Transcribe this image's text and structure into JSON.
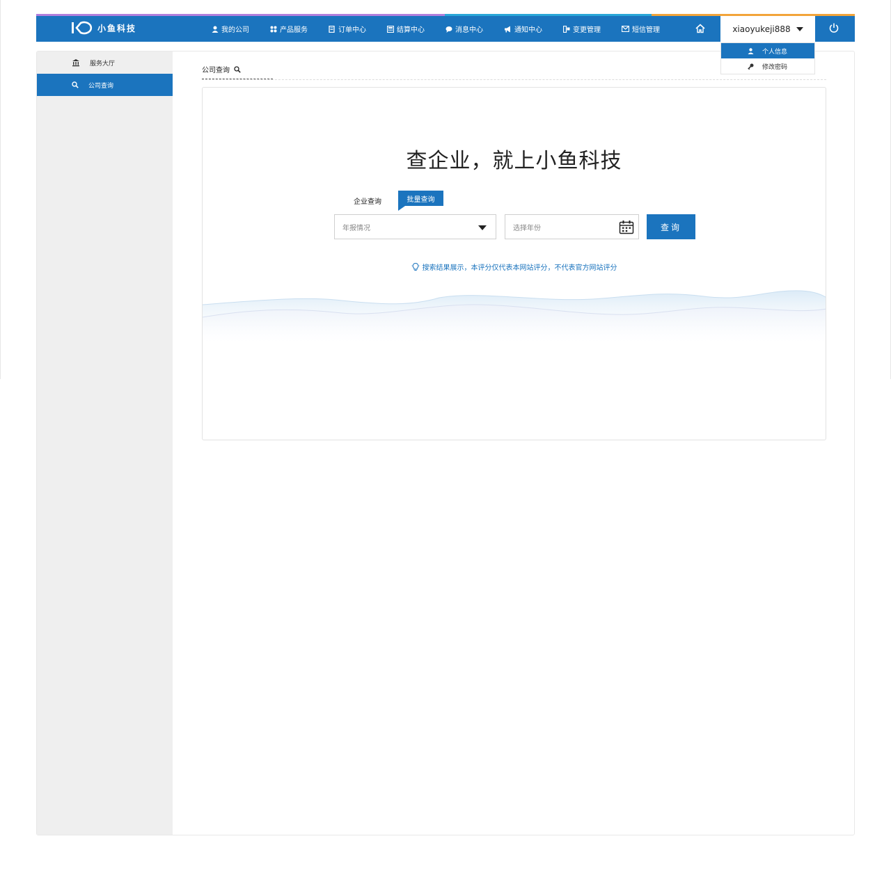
{
  "brand": {
    "logo_text": "小鱼科技"
  },
  "nav": {
    "items": [
      {
        "label": "我的公司",
        "icon": "user-icon"
      },
      {
        "label": "产品服务",
        "icon": "grid-icon"
      },
      {
        "label": "订单中心",
        "icon": "order-icon"
      },
      {
        "label": "结算中心",
        "icon": "calculator-icon"
      },
      {
        "label": "消息中心",
        "icon": "chat-icon"
      },
      {
        "label": "通知中心",
        "icon": "megaphone-icon"
      },
      {
        "label": "变更管理",
        "icon": "change-icon"
      },
      {
        "label": "短信管理",
        "icon": "mail-icon"
      }
    ]
  },
  "user": {
    "name": "xiaoyukeji888",
    "menu": [
      {
        "label": "个人信息",
        "icon": "person-icon",
        "active": true
      },
      {
        "label": "修改密码",
        "icon": "key-icon",
        "active": false
      }
    ]
  },
  "sidebar": {
    "items": [
      {
        "label": "服务大厅",
        "icon": "bank-icon",
        "active": false
      },
      {
        "label": "公司查询",
        "icon": "search-icon",
        "active": true
      }
    ]
  },
  "breadcrumb": {
    "label": "公司查询"
  },
  "search": {
    "title": "查企业，就上小鱼科技",
    "tabs": [
      {
        "label": "企业查询",
        "active": false
      },
      {
        "label": "批量查询",
        "active": true
      }
    ],
    "select_value": "年报情况",
    "year_placeholder": "选择年份",
    "button": "查询",
    "tip": "搜索结果展示，本评分仅代表本网站评分，不代表官方网站评分"
  },
  "colors": {
    "primary": "#1b74be",
    "sidebar_bg": "#efefef"
  }
}
